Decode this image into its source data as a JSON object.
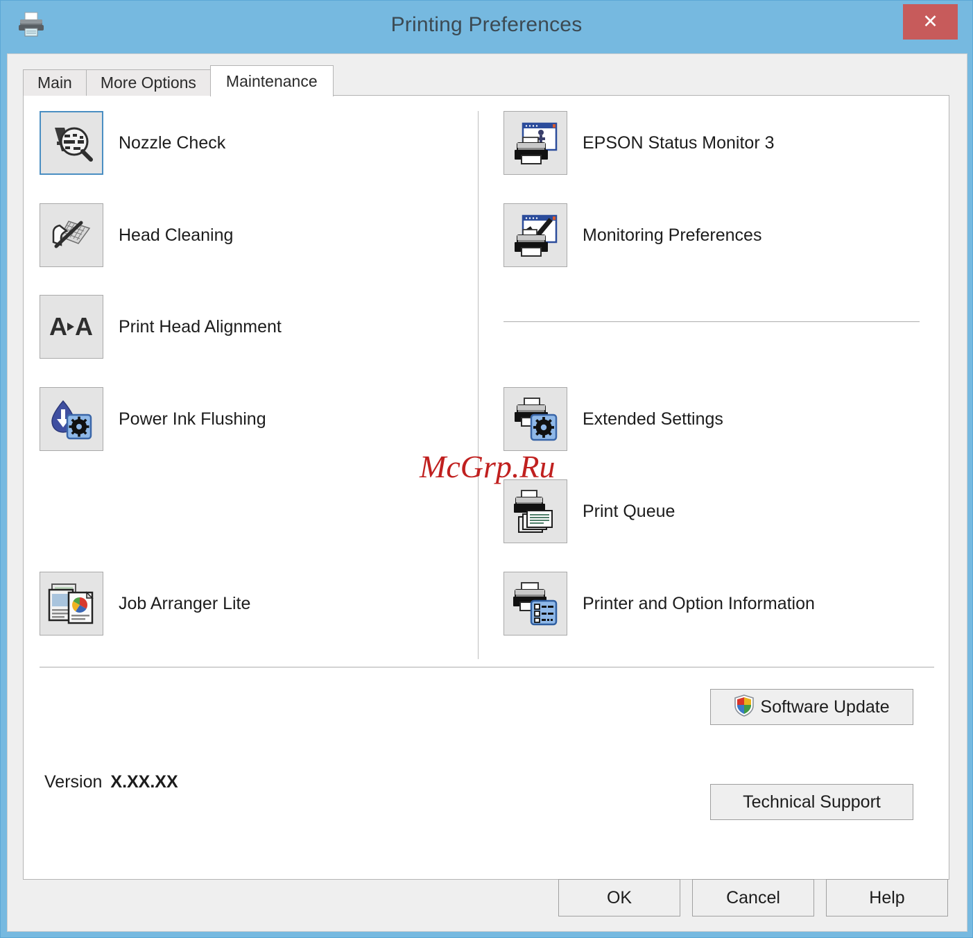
{
  "window": {
    "title": "Printing Preferences",
    "title_icon": "printer-icon",
    "close_label": "✕",
    "titlebar_color": "#76b9e0",
    "close_color": "#c75b5b"
  },
  "tabs": [
    {
      "label": "Main",
      "active": false
    },
    {
      "label": "More Options",
      "active": false
    },
    {
      "label": "Maintenance",
      "active": true
    }
  ],
  "maintenance": {
    "left_column": [
      {
        "label": "Nozzle Check",
        "icon": "nozzle-check-icon",
        "focused": true
      },
      {
        "label": "Head Cleaning",
        "icon": "head-cleaning-icon",
        "focused": false
      },
      {
        "label": "Print Head Alignment",
        "icon": "print-head-alignment-icon",
        "focused": false
      },
      {
        "label": "Power Ink Flushing",
        "icon": "power-ink-flushing-icon",
        "focused": false
      },
      {
        "label": "Job Arranger Lite",
        "icon": "job-arranger-lite-icon",
        "focused": false
      }
    ],
    "right_column": [
      {
        "label": "EPSON Status Monitor 3",
        "icon": "epson-status-monitor-icon",
        "focused": false
      },
      {
        "label": "Monitoring Preferences",
        "icon": "monitoring-preferences-icon",
        "focused": false
      },
      {
        "label": "Extended Settings",
        "icon": "extended-settings-icon",
        "focused": false
      },
      {
        "label": "Print Queue",
        "icon": "print-queue-icon",
        "focused": false
      },
      {
        "label": "Printer and Option Information",
        "icon": "printer-option-info-icon",
        "focused": false
      }
    ]
  },
  "bottom": {
    "software_update": {
      "label": "Software Update",
      "icon": "windows-shield-icon"
    },
    "version_label": "Version",
    "version_value": "X.XX.XX",
    "technical_support": "Technical Support"
  },
  "footer": {
    "ok": "OK",
    "cancel": "Cancel",
    "help": "Help"
  },
  "watermark": {
    "text": "McGrp.Ru",
    "color": "#c0201f"
  }
}
